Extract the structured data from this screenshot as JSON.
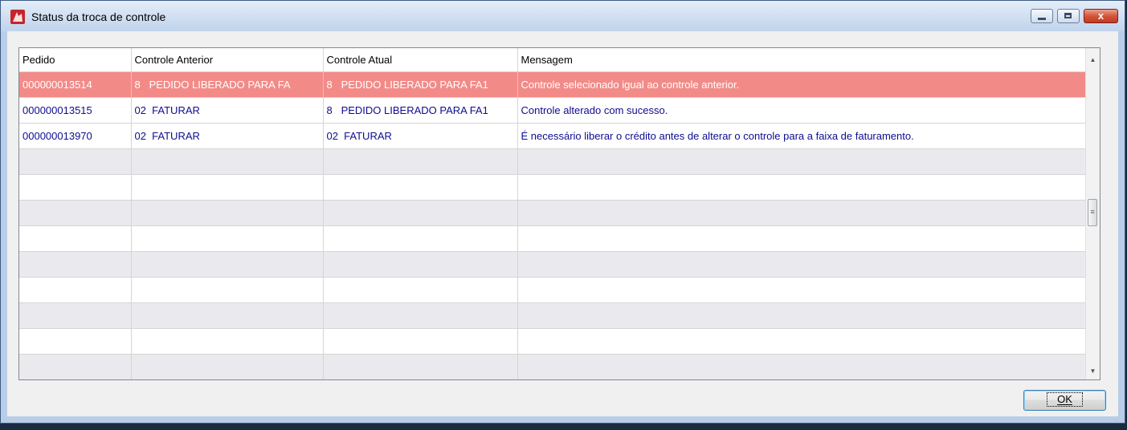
{
  "window": {
    "title": "Status da troca de controle",
    "close_glyph": "x"
  },
  "table": {
    "columns": [
      "Pedido",
      "Controle Anterior",
      "Controle Atual",
      "Mensagem"
    ],
    "rows": [
      {
        "pedido": "000000013514",
        "anterior": "8   PEDIDO LIBERADO PARA FA",
        "atual": "8   PEDIDO LIBERADO PARA FA1",
        "mensagem": "Controle selecionado igual ao controle anterior.",
        "status": "error"
      },
      {
        "pedido": "000000013515",
        "anterior": "02  FATURAR",
        "atual": "8   PEDIDO LIBERADO PARA FA1",
        "mensagem": "Controle alterado com sucesso.",
        "status": "ok"
      },
      {
        "pedido": "000000013970",
        "anterior": "02  FATURAR",
        "atual": "02  FATURAR",
        "mensagem": "É necessário liberar o crédito antes de alterar o controle para a faixa de faturamento.",
        "status": "ok"
      }
    ]
  },
  "buttons": {
    "ok_label": "OK"
  },
  "colors": {
    "error_row": "#f28b88",
    "text_blue": "#0d0d8f"
  }
}
